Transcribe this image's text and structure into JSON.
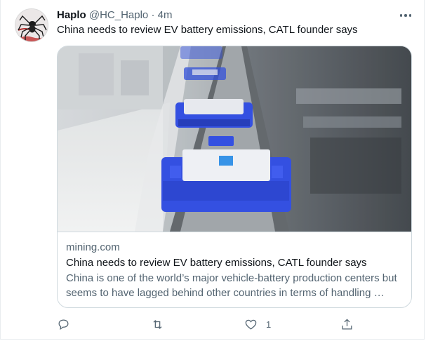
{
  "tweet": {
    "author_name": "Haplo",
    "handle": "@HC_Haplo",
    "separator": "·",
    "time": "4m",
    "text": "China needs to review EV battery emissions, CATL founder says",
    "more_icon": "ellipsis-icon"
  },
  "card": {
    "image_icon": "battery-production-line-photo",
    "domain": "mining.com",
    "title": "China needs to review EV battery emissions, CATL founder says",
    "description": "China is one of the world’s major vehicle-battery production centers but seems to have lagged behind other countries in terms of handling …"
  },
  "actions": {
    "reply_icon": "reply-icon",
    "retweet_icon": "retweet-icon",
    "like_icon": "heart-icon",
    "like_count": "1",
    "share_icon": "share-icon"
  },
  "colors": {
    "text_primary": "#0f1419",
    "text_secondary": "#536471",
    "border": "#cfd9de"
  }
}
